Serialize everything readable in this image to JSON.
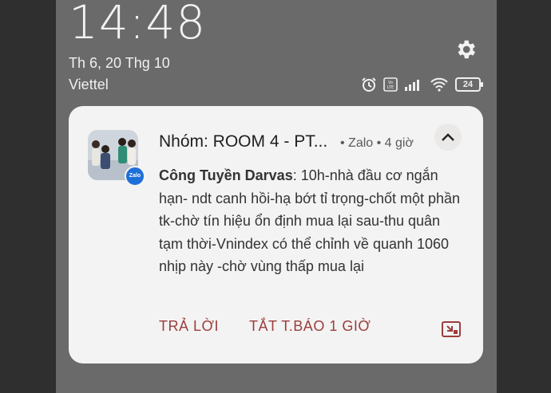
{
  "lockscreen": {
    "time": "14:48",
    "date": "Th 6, 20 Thg 10",
    "carrier": "Viettel",
    "battery": "24",
    "icons": [
      "gear-icon",
      "alarm-icon",
      "volte-icon",
      "signal-icon",
      "wifi-icon",
      "battery-icon"
    ]
  },
  "notification": {
    "title": "Nhóm: ROOM 4 - PT...",
    "app": "• Zalo • 4 giờ",
    "sender": "Công Tuyền Darvas",
    "message": ": 10h-nhà đầu cơ ngắn hạn- ndt canh hồi-hạ bớt tỉ trọng-chốt một phần tk-chờ tín hiệu ổn định mua lại sau-thu quân tạm thời-Vnindex có thể chỉnh về quanh 1060 nhịp này -chờ vùng thấp mua lại",
    "badge": "Zalo",
    "actions": {
      "reply": "TRẢ LỜI",
      "mute": "TẮT T.BÁO 1 GIỜ"
    },
    "accent_color": "#9b3d3d"
  }
}
